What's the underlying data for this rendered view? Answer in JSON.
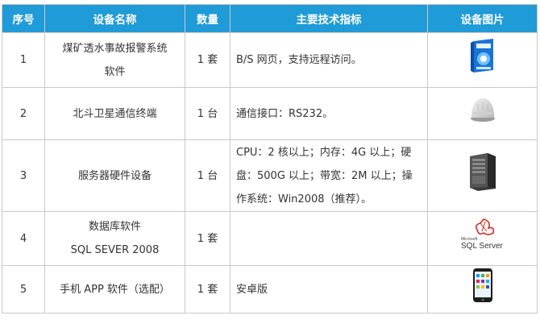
{
  "header": {
    "col_index": "序号",
    "col_name": "设备名称",
    "col_qty": "数量",
    "col_spec": "主要技术指标",
    "col_image": "设备图片"
  },
  "rows": [
    {
      "index": "1",
      "name_lines": [
        "煤矿透水事故报警系统",
        "软件"
      ],
      "qty": "1 套",
      "spec_lines": [
        "B/S 网页，支持远程访问。"
      ],
      "image": "software-box-icon"
    },
    {
      "index": "2",
      "name_lines": [
        "北斗卫星通信终端"
      ],
      "qty": "1 台",
      "spec_lines": [
        "通信接口：RS232。"
      ],
      "image": "satellite-terminal-icon"
    },
    {
      "index": "3",
      "name_lines": [
        "服务器硬件设备"
      ],
      "qty": "1 台",
      "spec_lines": [
        "CPU：2 核以上；内存：4G 以上；硬",
        "盘：500G 以上；带宽：2M 以上；操",
        "作系统：Win2008（推荐）。"
      ],
      "image": "server-tower-icon"
    },
    {
      "index": "4",
      "name_lines": [
        "数据库软件",
        "SQL SEVER 2008"
      ],
      "qty": "1 套",
      "spec_lines": [],
      "image": "sql-server-logo",
      "logo_text": [
        "Microsoft",
        "SQL Server"
      ]
    },
    {
      "index": "5",
      "name_lines": [
        "手机 APP 软件（选配）"
      ],
      "qty": "1 套",
      "spec_lines": [
        "安卓版"
      ],
      "image": "smartphone-icon"
    }
  ],
  "colors": {
    "header_bg": "#1f9bd8",
    "header_text": "#ffffff",
    "border": "#c9c9c9",
    "text": "#333333"
  }
}
